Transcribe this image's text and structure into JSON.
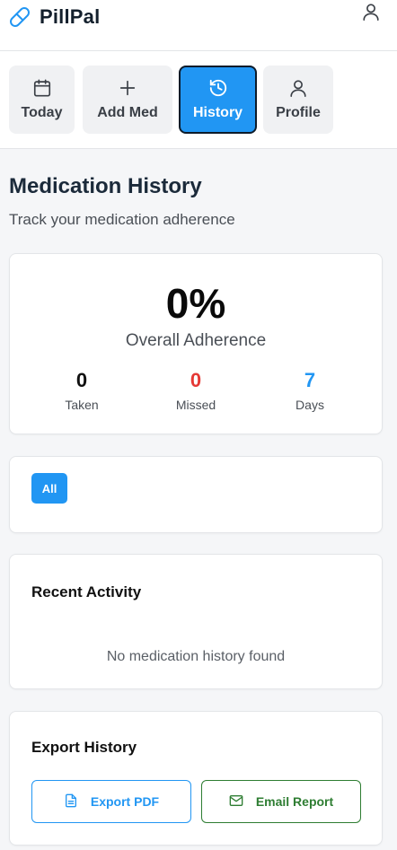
{
  "app": {
    "name": "PillPal"
  },
  "nav": {
    "tabs": [
      {
        "label": "Today",
        "icon": "calendar-icon",
        "active": false
      },
      {
        "label": "Add Med",
        "icon": "plus-icon",
        "active": false
      },
      {
        "label": "History",
        "icon": "history-icon",
        "active": true
      },
      {
        "label": "Profile",
        "icon": "user-icon",
        "active": false
      }
    ]
  },
  "page": {
    "title": "Medication History",
    "subtitle": "Track your medication adherence"
  },
  "adherence": {
    "value": "0%",
    "label": "Overall Adherence",
    "stats": [
      {
        "value": "0",
        "label": "Taken",
        "color": "#111111"
      },
      {
        "value": "0",
        "label": "Missed",
        "color": "#e53935"
      },
      {
        "value": "7",
        "label": "Days",
        "color": "#2196f3"
      }
    ]
  },
  "filters": {
    "items": [
      "All"
    ],
    "selected": "All"
  },
  "recent": {
    "heading": "Recent Activity",
    "empty_text": "No medication history found"
  },
  "export": {
    "heading": "Export History",
    "pdf_label": "Export PDF",
    "email_label": "Email Report"
  },
  "colors": {
    "accent": "#2196f3",
    "danger": "#e53935",
    "success": "#2e7d32"
  }
}
